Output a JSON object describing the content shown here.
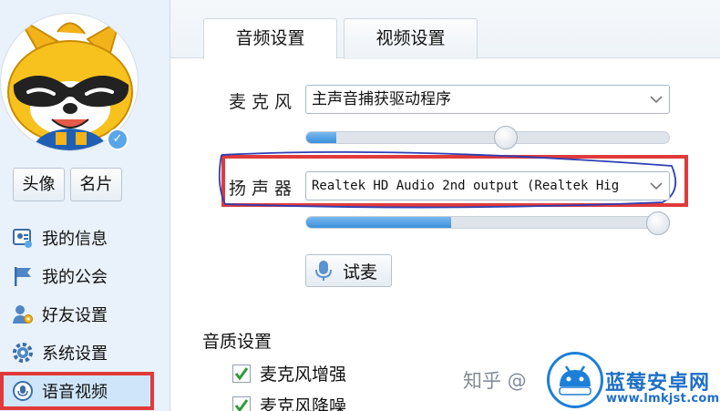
{
  "sidebar": {
    "avatar_buttons": [
      "头像",
      "名片"
    ],
    "items": [
      {
        "label": "我的信息",
        "icon": "profile-card-icon"
      },
      {
        "label": "我的公会",
        "icon": "flag-icon"
      },
      {
        "label": "好友设置",
        "icon": "friend-settings-icon"
      },
      {
        "label": "系统设置",
        "icon": "gear-icon"
      },
      {
        "label": "语音视频",
        "icon": "voice-video-icon",
        "active": true
      }
    ]
  },
  "tabs": [
    {
      "label": "音频设置",
      "active": true
    },
    {
      "label": "视频设置",
      "active": false
    }
  ],
  "audio": {
    "mic_label": "麦克风",
    "mic_device": "主声音捕获驱动程序",
    "mic_volume": 0.55,
    "speaker_label": "扬声器",
    "speaker_device": "Realtek HD Audio 2nd output (Realtek Hig",
    "speaker_volume": 1.0,
    "test_button": "试麦"
  },
  "quality": {
    "title": "音质设置",
    "options": [
      {
        "label": "麦克风增强",
        "checked": true
      },
      {
        "label": "麦克风降噪",
        "checked": true
      }
    ]
  },
  "watermark": {
    "zhihu": "知乎 @",
    "site_name": "蓝莓安卓网",
    "site_url": "www.lmkjst.com"
  },
  "colors": {
    "highlight": "#e03a3a",
    "accent": "#3b8fdc",
    "sidebar_bg": "#e9f2fb"
  }
}
